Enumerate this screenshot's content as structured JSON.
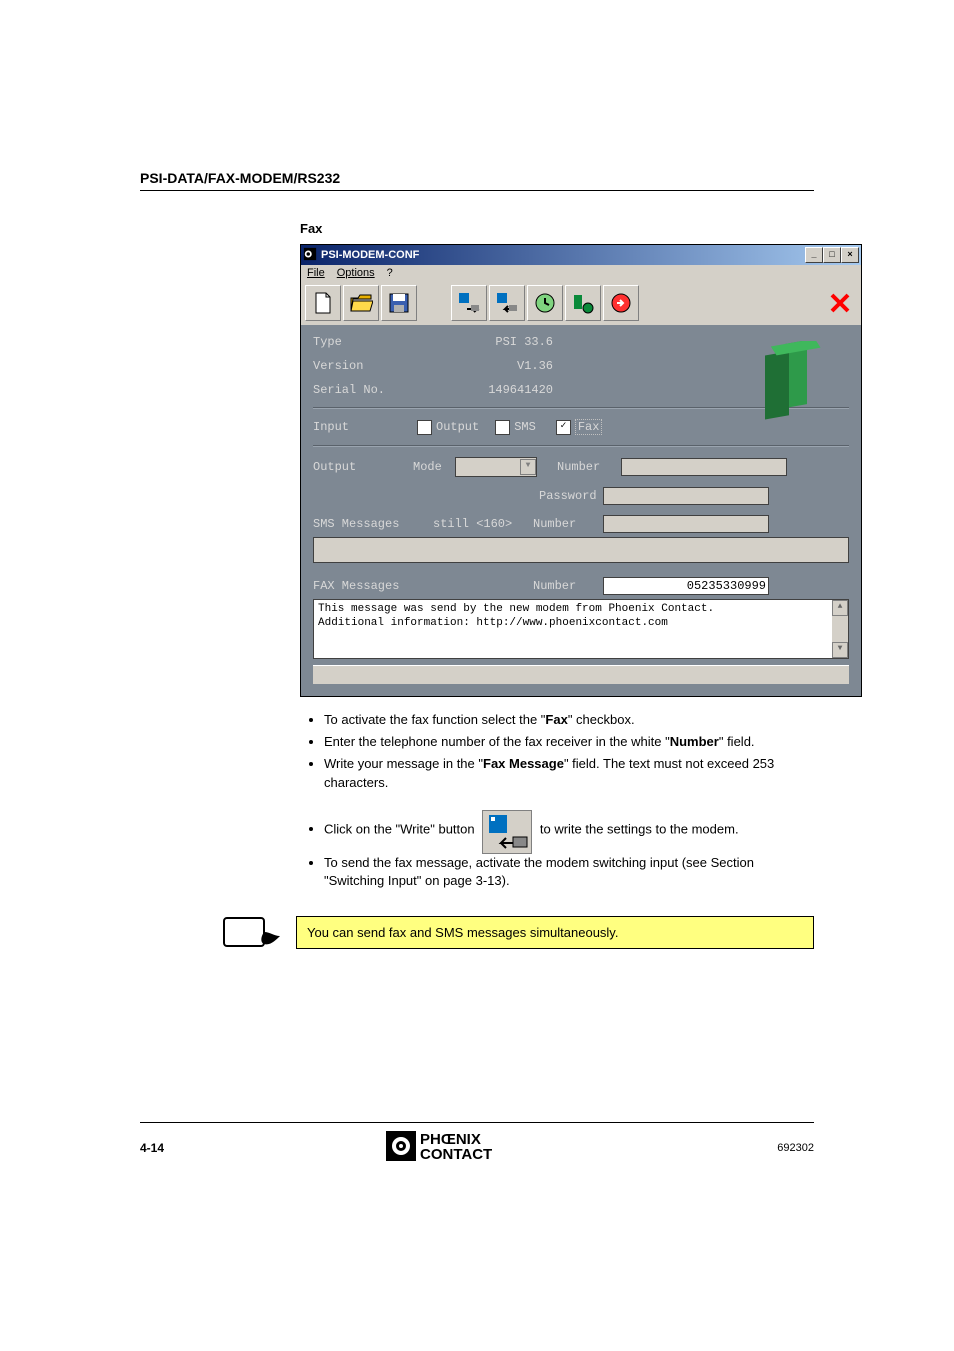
{
  "doc": {
    "header": "PSI-DATA/FAX-MODEM/RS232",
    "section": "Fax",
    "page_number": "4-14",
    "doc_number": "692302"
  },
  "window": {
    "title": "PSI-MODEM-CONF",
    "menus": {
      "file": "File",
      "options": "Options",
      "help": "?"
    },
    "info": {
      "type_label": "Type",
      "type_value": "PSI 33.6",
      "version_label": "Version",
      "version_value": "V1.36",
      "serial_label": "Serial No.",
      "serial_value": "149641420"
    },
    "input": {
      "label": "Input",
      "output_label": "Output",
      "sms_label": "SMS",
      "fax_label": "Fax",
      "output_checked": false,
      "sms_checked": false,
      "fax_checked": true
    },
    "output": {
      "label": "Output",
      "mode_label": "Mode",
      "number_label": "Number",
      "password_label": "Password",
      "number_value": "",
      "password_value": ""
    },
    "sms": {
      "label": "SMS Messages",
      "still": "still <160>",
      "number_label": "Number",
      "number_value": "",
      "message": ""
    },
    "fax": {
      "label": "FAX Messages",
      "number_label": "Number",
      "number_value": "05235330999",
      "message": "This message was send by the new modem from Phoenix Contact.\nAdditional information: http://www.phoenixcontact.com"
    }
  },
  "instructions": {
    "b1_pre": "To activate the fax function select the \"",
    "b1_bold": "Fax",
    "b1_post": "\" checkbox.",
    "b2_pre": "Enter the telephone number of the fax receiver in the white \"",
    "b2_bold": "Number",
    "b2_post": "\" field.",
    "b3_pre": "Write your message in the \"",
    "b3_bold": "Fax Message",
    "b3_post": "\" field. The text must not exceed 253 characters.",
    "b4_pre": "Click on the \"Write\" button ",
    "b4_post": " to write the settings to the modem.",
    "b5": "To send the fax message, activate the modem switching input (see Section \"Switching Input\" on page 3-13)."
  },
  "note": "You can send fax and SMS messages simultaneously.",
  "footer_brand_top": "PHŒNIX",
  "footer_brand_bot": "CONTACT"
}
